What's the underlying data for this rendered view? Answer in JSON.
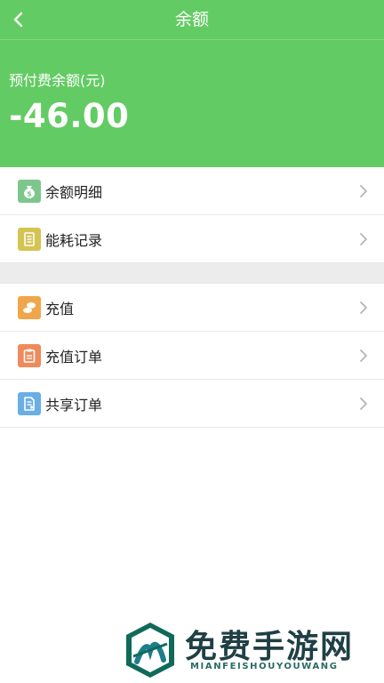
{
  "header": {
    "title": "余额",
    "back_icon": "chevron-left-icon"
  },
  "balance": {
    "label": "预付费余额(元)",
    "amount": "-46.00"
  },
  "menu_group_1": [
    {
      "label": "余额明细",
      "icon": "money-bag-icon",
      "icon_color": "#7dc78c"
    },
    {
      "label": "能耗记录",
      "icon": "notebook-icon",
      "icon_color": "#d4c452"
    }
  ],
  "menu_group_2": [
    {
      "label": "充值",
      "icon": "coins-icon",
      "icon_color": "#f0a64a"
    },
    {
      "label": "充值订单",
      "icon": "clipboard-icon",
      "icon_color": "#ef8a5a"
    },
    {
      "label": "共享订单",
      "icon": "document-icon",
      "icon_color": "#6aaee6"
    }
  ],
  "watermark": {
    "cn": "免费手游网",
    "en": "MIANFEISHOUYOUWANG"
  },
  "colors": {
    "accent": "#63cb63",
    "divider": "#e8e8e8",
    "gap": "#ececec"
  }
}
